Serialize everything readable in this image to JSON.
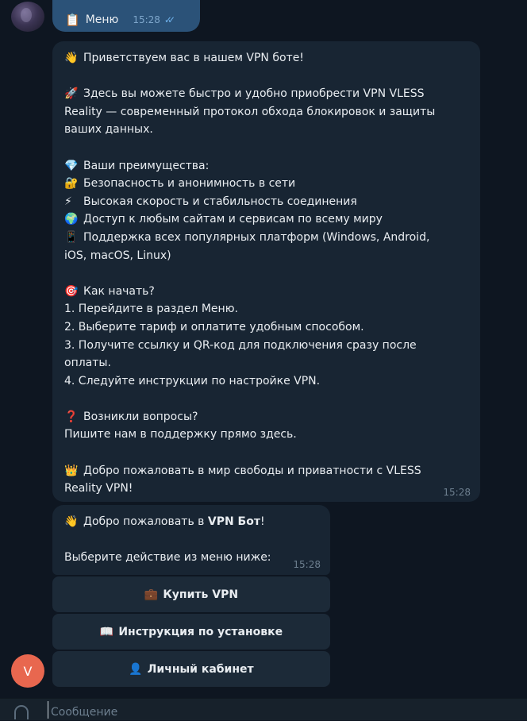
{
  "outgoing": {
    "emoji": "📋",
    "text": "Меню",
    "time": "15:28",
    "status": "read"
  },
  "welcome_message": {
    "lines": [
      {
        "emoji": "👋",
        "text": "Приветствуем вас в нашем VPN боте!"
      },
      {
        "emoji": "",
        "text": ""
      },
      {
        "emoji": "🚀",
        "text": "Здесь вы можете быстро и удобно приобрести VPN VLESS"
      },
      {
        "emoji": "",
        "text": "Reality — современный протокол обхода блокировок и защиты"
      },
      {
        "emoji": "",
        "text": "ваших данных."
      },
      {
        "emoji": "",
        "text": ""
      },
      {
        "emoji": "💎",
        "text": "Ваши преимущества:"
      },
      {
        "emoji": "🔐",
        "text": "Безопасность и анонимность в сети"
      },
      {
        "emoji": "⚡",
        "text": "Высокая скорость и стабильность соединения"
      },
      {
        "emoji": "🌍",
        "text": "Доступ к любым сайтам и сервисам по всему миру"
      },
      {
        "emoji": "📱",
        "text": "Поддержка всех популярных платформ (Windows, Android,"
      },
      {
        "emoji": "",
        "text": "iOS, macOS, Linux)"
      },
      {
        "emoji": "",
        "text": ""
      },
      {
        "emoji": "🎯",
        "text": "Как начать?"
      },
      {
        "emoji": "",
        "text": "1. Перейдите в раздел Меню."
      },
      {
        "emoji": "",
        "text": "2. Выберите тариф и оплатите удобным способом."
      },
      {
        "emoji": "",
        "text": "3. Получите ссылку и QR-код для подключения сразу после"
      },
      {
        "emoji": "",
        "text": "оплаты."
      },
      {
        "emoji": "",
        "text": "4. Следуйте инструкции по настройке VPN."
      },
      {
        "emoji": "",
        "text": ""
      },
      {
        "emoji": "❓",
        "text": "Возникли вопросы?"
      },
      {
        "emoji": "",
        "text": "Пишите нам в поддержку прямо здесь."
      },
      {
        "emoji": "",
        "text": ""
      },
      {
        "emoji": "👑",
        "text": "Добро пожаловать в мир свободы и приватности с VLESS"
      },
      {
        "emoji": "",
        "text": "Reality VPN!"
      }
    ],
    "time": "15:28"
  },
  "menu_message": {
    "greeting_emoji": "👋",
    "greeting_prefix": "Добро пожаловать в ",
    "greeting_bold": "VPN Бот",
    "greeting_suffix": "!",
    "prompt": "Выберите действие из меню ниже:",
    "time": "15:28"
  },
  "keyboard": [
    {
      "emoji": "💼",
      "label": "Купить VPN"
    },
    {
      "emoji": "📖",
      "label": "Инструкция по установке"
    },
    {
      "emoji": "👤",
      "label": "Личный кабинет"
    }
  ],
  "bot_avatar_letter": "V",
  "compose": {
    "placeholder": "Сообщение"
  },
  "colors": {
    "background": "#0e1621",
    "incoming_bubble": "#182533",
    "outgoing_bubble": "#2b5278",
    "avatar_bot": "#e8674f",
    "read_checks": "#6fb2ec"
  }
}
